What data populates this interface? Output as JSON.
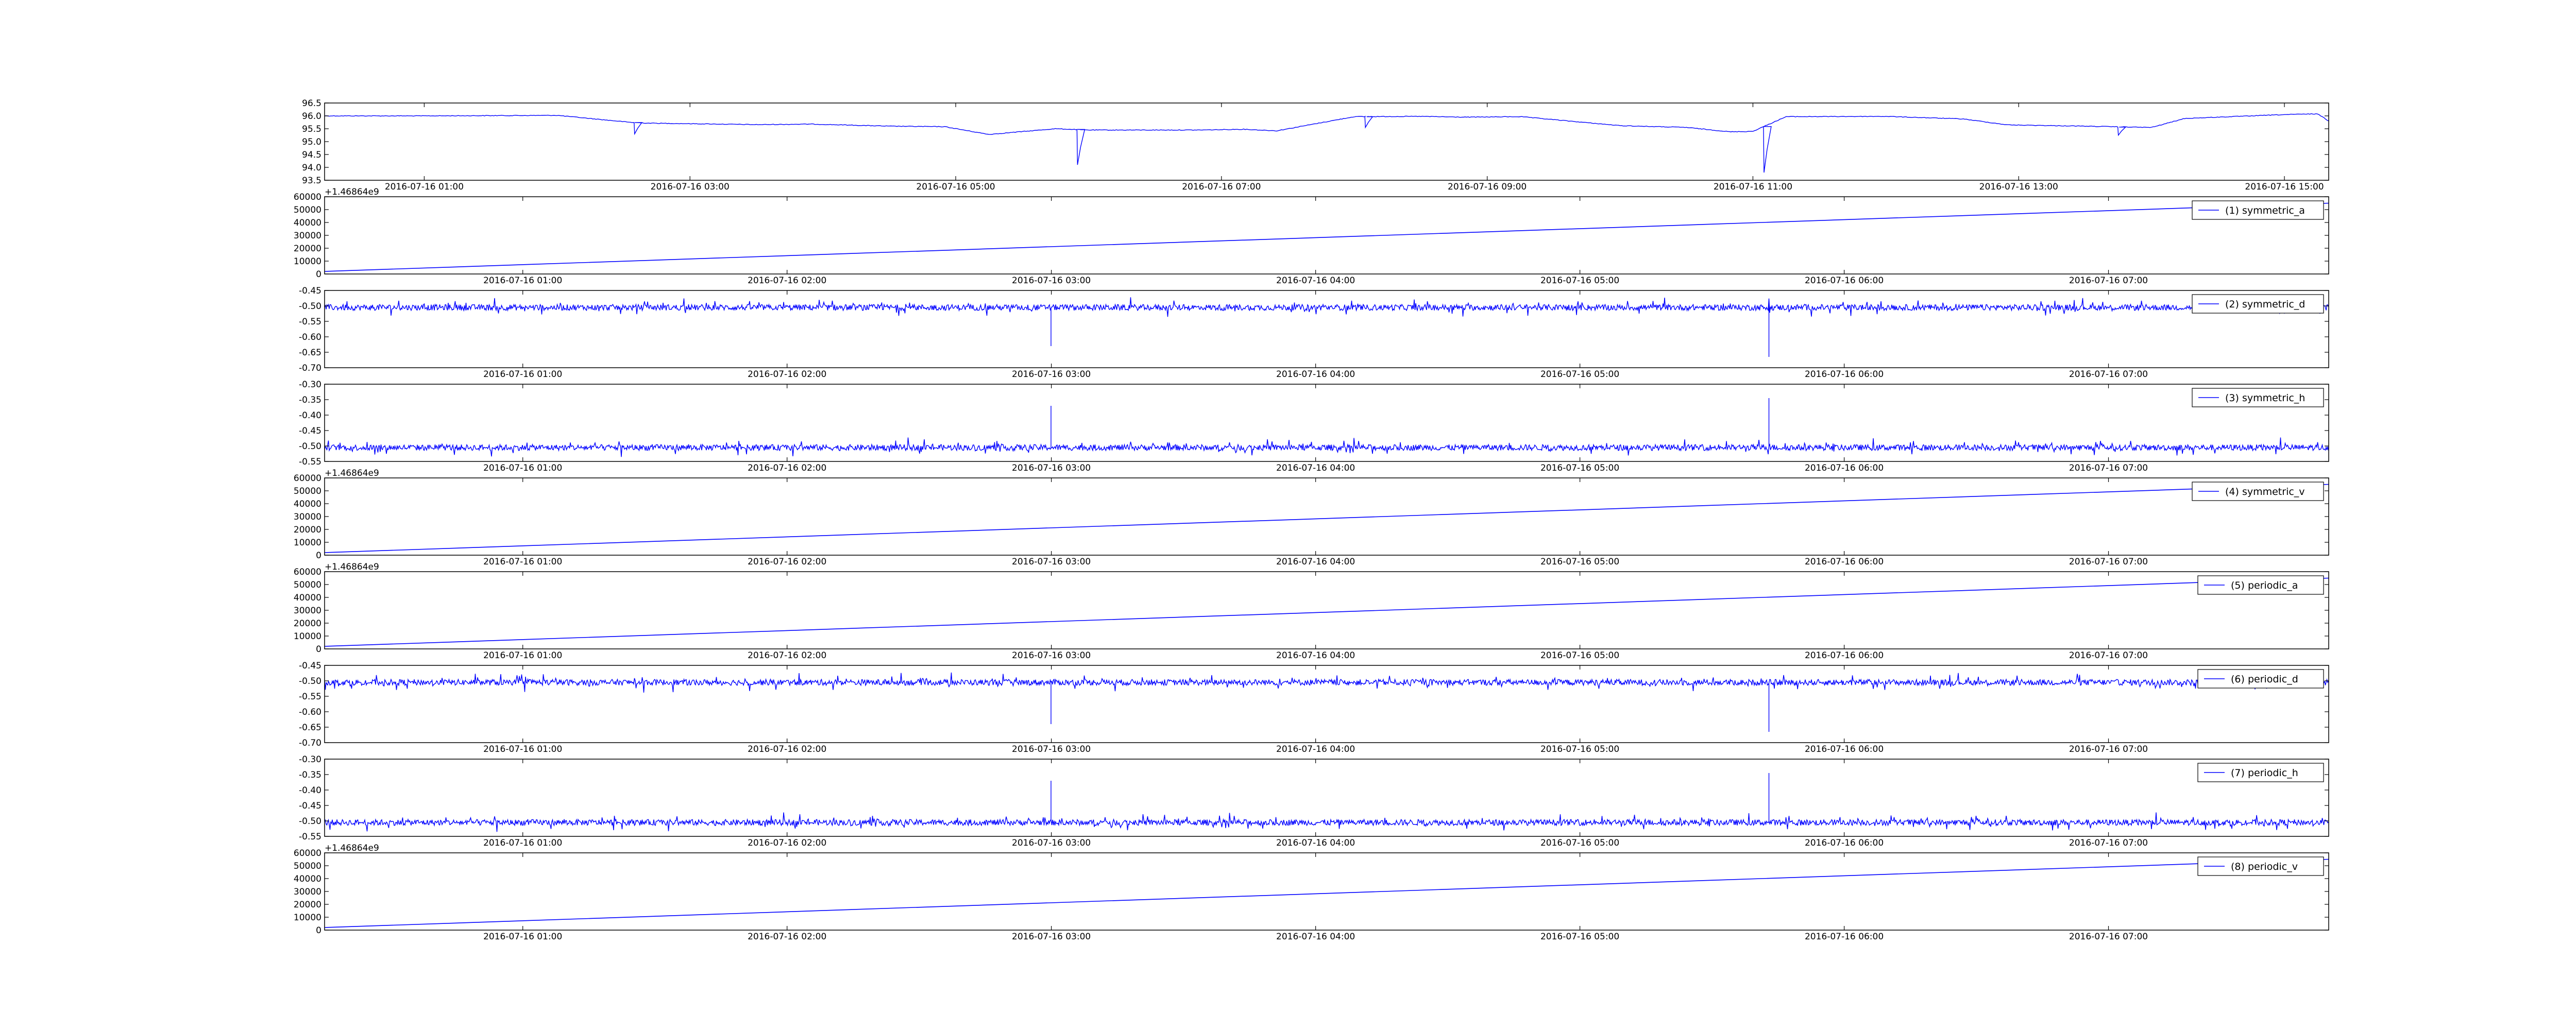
{
  "figure": {
    "background": "#ffffff",
    "line_color": "#0000ff"
  },
  "chart_data": [
    {
      "type": "line",
      "title": "",
      "xlabel": "",
      "ylabel": "",
      "ylim": [
        93.5,
        96.5
      ],
      "yticks": [
        "93.5",
        "94.0",
        "94.5",
        "95.0",
        "95.5",
        "96.0",
        "96.5"
      ],
      "xlim": [
        "2016-07-16 00:15",
        "2016-07-16 15:20"
      ],
      "xticks": [
        "2016-07-16 01:00",
        "2016-07-16 03:00",
        "2016-07-16 05:00",
        "2016-07-16 07:00",
        "2016-07-16 09:00",
        "2016-07-16 11:00",
        "2016-07-16 13:00",
        "2016-07-16 15:00"
      ],
      "offset_text": "",
      "legend": "",
      "legend_position": "",
      "series": [
        {
          "x": [
            "2016-07-16 00:15",
            "2016-07-16 01:00",
            "2016-07-16 02:00",
            "2016-07-16 02:33",
            "2016-07-16 02:40",
            "2016-07-16 03:30",
            "2016-07-16 03:55",
            "2016-07-16 04:30",
            "2016-07-16 04:55",
            "2016-07-16 05:15",
            "2016-07-16 05:45",
            "2016-07-16 06:00",
            "2016-07-16 06:50",
            "2016-07-16 07:10",
            "2016-07-16 07:25",
            "2016-07-16 08:00",
            "2016-07-16 08:30",
            "2016-07-16 08:50",
            "2016-07-16 09:15",
            "2016-07-16 10:00",
            "2016-07-16 10:30",
            "2016-07-16 10:50",
            "2016-07-16 11:00",
            "2016-07-16 11:15",
            "2016-07-16 12:00",
            "2016-07-16 12:35",
            "2016-07-16 12:55",
            "2016-07-16 13:30",
            "2016-07-16 14:00",
            "2016-07-16 14:15",
            "2016-07-16 15:00",
            "2016-07-16 15:15",
            "2016-07-16 15:20"
          ],
          "y": [
            96.0,
            96.0,
            96.02,
            95.75,
            95.72,
            95.66,
            95.68,
            95.6,
            95.58,
            95.28,
            95.5,
            95.45,
            95.45,
            95.48,
            95.42,
            95.97,
            95.98,
            95.95,
            95.97,
            95.62,
            95.55,
            95.38,
            95.4,
            95.97,
            95.98,
            95.88,
            95.65,
            95.6,
            95.55,
            95.9,
            96.05,
            96.08,
            95.8
          ],
          "spikes": [
            {
              "x": "2016-07-16 02:35",
              "y": 95.3
            },
            {
              "x": "2016-07-16 05:55",
              "y": 94.1
            },
            {
              "x": "2016-07-16 08:05",
              "y": 95.55
            },
            {
              "x": "2016-07-16 11:05",
              "y": 93.8
            },
            {
              "x": "2016-07-16 13:45",
              "y": 95.25
            }
          ]
        }
      ]
    },
    {
      "type": "line",
      "ylim": [
        0,
        60000
      ],
      "yticks": [
        "0",
        "10000",
        "20000",
        "30000",
        "40000",
        "50000",
        "60000"
      ],
      "xlim": [
        "2016-07-16 00:15",
        "2016-07-16 07:50"
      ],
      "xticks": [
        "2016-07-16 01:00",
        "2016-07-16 02:00",
        "2016-07-16 03:00",
        "2016-07-16 04:00",
        "2016-07-16 05:00",
        "2016-07-16 06:00",
        "2016-07-16 07:00"
      ],
      "offset_text": "+1.46864e9",
      "legend": "(1) symmetric_a",
      "legend_position": "top-right",
      "series": [
        {
          "name": "(1) symmetric_a",
          "x": [
            "2016-07-16 00:15",
            "2016-07-16 07:50"
          ],
          "y": [
            2000,
            55000
          ]
        }
      ]
    },
    {
      "type": "line",
      "ylim": [
        -0.7,
        -0.45
      ],
      "yticks": [
        "-0.70",
        "-0.65",
        "-0.60",
        "-0.55",
        "-0.50",
        "-0.45"
      ],
      "xlim": [
        "2016-07-16 00:15",
        "2016-07-16 07:50"
      ],
      "xticks": [
        "2016-07-16 01:00",
        "2016-07-16 02:00",
        "2016-07-16 03:00",
        "2016-07-16 04:00",
        "2016-07-16 05:00",
        "2016-07-16 06:00",
        "2016-07-16 07:00"
      ],
      "offset_text": "",
      "legend": "(2) symmetric_d",
      "legend_position": "top-right",
      "series": [
        {
          "name": "(2) symmetric_d",
          "baseline": -0.505,
          "noise": 0.012,
          "spikes": [
            {
              "x": "2016-07-16 03:00",
              "y": -0.63
            },
            {
              "x": "2016-07-16 05:43",
              "y": -0.665
            }
          ]
        }
      ]
    },
    {
      "type": "line",
      "ylim": [
        -0.55,
        -0.3
      ],
      "yticks": [
        "-0.55",
        "-0.50",
        "-0.45",
        "-0.40",
        "-0.35",
        "-0.30"
      ],
      "xlim": [
        "2016-07-16 00:15",
        "2016-07-16 07:50"
      ],
      "xticks": [
        "2016-07-16 01:00",
        "2016-07-16 02:00",
        "2016-07-16 03:00",
        "2016-07-16 04:00",
        "2016-07-16 05:00",
        "2016-07-16 06:00",
        "2016-07-16 07:00"
      ],
      "offset_text": "",
      "legend": "(3) symmetric_h",
      "legend_position": "top-right",
      "series": [
        {
          "name": "(3) symmetric_h",
          "baseline": -0.505,
          "noise": 0.012,
          "spikes": [
            {
              "x": "2016-07-16 03:00",
              "y": -0.37
            },
            {
              "x": "2016-07-16 05:43",
              "y": -0.345
            }
          ]
        }
      ]
    },
    {
      "type": "line",
      "ylim": [
        0,
        60000
      ],
      "yticks": [
        "0",
        "10000",
        "20000",
        "30000",
        "40000",
        "50000",
        "60000"
      ],
      "xlim": [
        "2016-07-16 00:15",
        "2016-07-16 07:50"
      ],
      "xticks": [
        "2016-07-16 01:00",
        "2016-07-16 02:00",
        "2016-07-16 03:00",
        "2016-07-16 04:00",
        "2016-07-16 05:00",
        "2016-07-16 06:00",
        "2016-07-16 07:00"
      ],
      "offset_text": "+1.46864e9",
      "legend": "(4) symmetric_v",
      "legend_position": "top-right",
      "series": [
        {
          "name": "(4) symmetric_v",
          "x": [
            "2016-07-16 00:15",
            "2016-07-16 07:50"
          ],
          "y": [
            2000,
            55000
          ]
        }
      ]
    },
    {
      "type": "line",
      "ylim": [
        0,
        60000
      ],
      "yticks": [
        "0",
        "10000",
        "20000",
        "30000",
        "40000",
        "50000",
        "60000"
      ],
      "xlim": [
        "2016-07-16 00:15",
        "2016-07-16 07:50"
      ],
      "xticks": [
        "2016-07-16 01:00",
        "2016-07-16 02:00",
        "2016-07-16 03:00",
        "2016-07-16 04:00",
        "2016-07-16 05:00",
        "2016-07-16 06:00",
        "2016-07-16 07:00"
      ],
      "offset_text": "+1.46864e9",
      "legend": "(5) periodic_a",
      "legend_position": "top-right",
      "series": [
        {
          "name": "(5) periodic_a",
          "x": [
            "2016-07-16 00:15",
            "2016-07-16 07:50"
          ],
          "y": [
            2000,
            55000
          ]
        }
      ]
    },
    {
      "type": "line",
      "ylim": [
        -0.7,
        -0.45
      ],
      "yticks": [
        "-0.70",
        "-0.65",
        "-0.60",
        "-0.55",
        "-0.50",
        "-0.45"
      ],
      "xlim": [
        "2016-07-16 00:15",
        "2016-07-16 07:50"
      ],
      "xticks": [
        "2016-07-16 01:00",
        "2016-07-16 02:00",
        "2016-07-16 03:00",
        "2016-07-16 04:00",
        "2016-07-16 05:00",
        "2016-07-16 06:00",
        "2016-07-16 07:00"
      ],
      "offset_text": "",
      "legend": "(6) periodic_d",
      "legend_position": "top-right",
      "series": [
        {
          "name": "(6) periodic_d",
          "baseline": -0.505,
          "noise": 0.012,
          "spikes": [
            {
              "x": "2016-07-16 03:00",
              "y": -0.64
            },
            {
              "x": "2016-07-16 05:43",
              "y": -0.665
            }
          ]
        }
      ]
    },
    {
      "type": "line",
      "ylim": [
        -0.55,
        -0.3
      ],
      "yticks": [
        "-0.55",
        "-0.50",
        "-0.45",
        "-0.40",
        "-0.35",
        "-0.30"
      ],
      "xlim": [
        "2016-07-16 00:15",
        "2016-07-16 07:50"
      ],
      "xticks": [
        "2016-07-16 01:00",
        "2016-07-16 02:00",
        "2016-07-16 03:00",
        "2016-07-16 04:00",
        "2016-07-16 05:00",
        "2016-07-16 06:00",
        "2016-07-16 07:00"
      ],
      "offset_text": "",
      "legend": "(7) periodic_h",
      "legend_position": "top-right",
      "series": [
        {
          "name": "(7) periodic_h",
          "baseline": -0.505,
          "noise": 0.012,
          "spikes": [
            {
              "x": "2016-07-16 03:00",
              "y": -0.37
            },
            {
              "x": "2016-07-16 05:43",
              "y": -0.345
            }
          ]
        }
      ]
    },
    {
      "type": "line",
      "ylim": [
        0,
        60000
      ],
      "yticks": [
        "0",
        "10000",
        "20000",
        "30000",
        "40000",
        "50000",
        "60000"
      ],
      "xlim": [
        "2016-07-16 00:15",
        "2016-07-16 07:50"
      ],
      "xticks": [
        "2016-07-16 01:00",
        "2016-07-16 02:00",
        "2016-07-16 03:00",
        "2016-07-16 04:00",
        "2016-07-16 05:00",
        "2016-07-16 06:00",
        "2016-07-16 07:00"
      ],
      "offset_text": "+1.46864e9",
      "legend": "(8) periodic_v",
      "legend_position": "top-right",
      "series": [
        {
          "name": "(8) periodic_v",
          "x": [
            "2016-07-16 00:15",
            "2016-07-16 07:50"
          ],
          "y": [
            2000,
            55000
          ]
        }
      ]
    }
  ]
}
